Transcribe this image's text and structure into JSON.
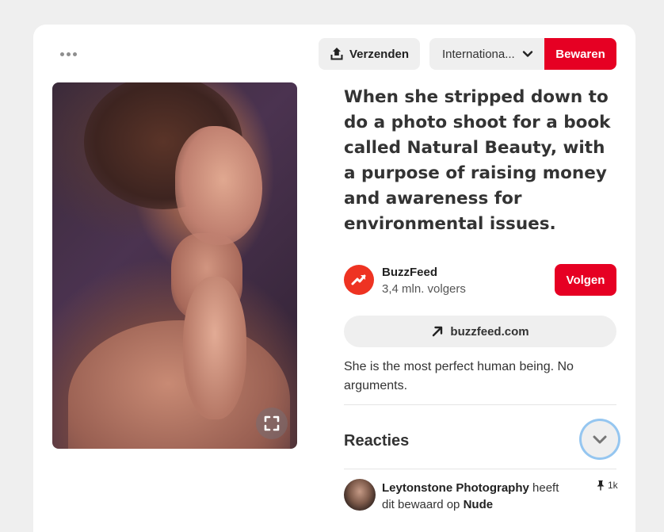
{
  "toolbar": {
    "send_label": "Verzenden",
    "board_select_value": "Internationa...",
    "save_label": "Bewaren",
    "accent": "#e60023"
  },
  "pin": {
    "title": "When she stripped down to do a photo shoot for a book called Natural Beauty, with a purpose of raising money and awareness for environmental issues.",
    "description": "She is the most perfect human being. No arguments.",
    "link_label": "buzzfeed.com",
    "image_alt_icon": "expand-icon"
  },
  "creator": {
    "name": "BuzzFeed",
    "followers": "3,4 mln. volgers",
    "follow_label": "Volgen",
    "avatar_icon": "trending-arrow-icon",
    "avatar_color": "#ee3322"
  },
  "comments": {
    "title": "Reacties",
    "toggle_icon": "chevron-down-icon"
  },
  "saved_by": {
    "name": "Leytonstone Photography",
    "verb": "heeft",
    "text": "dit bewaard op",
    "board": "Nude",
    "repin_count": "1k"
  }
}
